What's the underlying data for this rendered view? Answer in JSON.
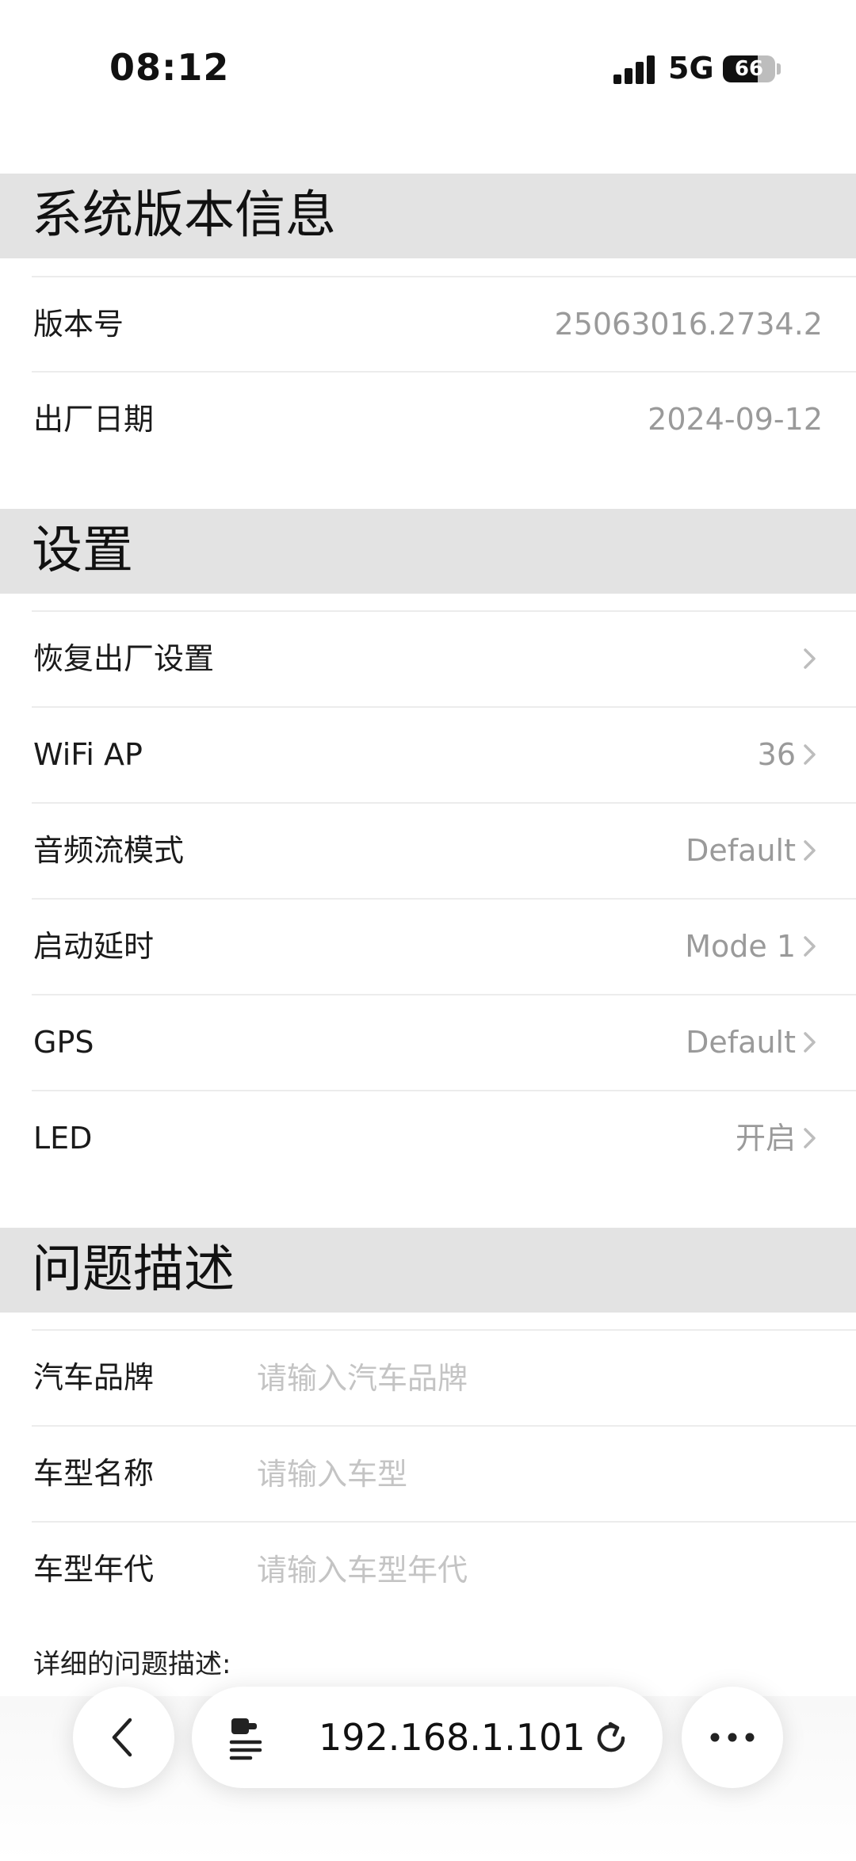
{
  "status_bar": {
    "time": "08:12",
    "network": "5G",
    "battery": "66",
    "battery_level_percent": 66,
    "icons": [
      "signal-icon",
      "battery-icon"
    ]
  },
  "sections": {
    "system": {
      "title": "系统版本信息",
      "rows": [
        {
          "label": "版本号",
          "value": "25063016.2734.2"
        },
        {
          "label": "出厂日期",
          "value": "2024-09-12"
        }
      ]
    },
    "settings": {
      "title": "设置",
      "rows": [
        {
          "label": "恢复出厂设置",
          "value": ""
        },
        {
          "label": "WiFi AP",
          "value": "36"
        },
        {
          "label": "音频流模式",
          "value": "Default"
        },
        {
          "label": "启动延时",
          "value": "Mode 1"
        },
        {
          "label": "GPS",
          "value": "Default"
        },
        {
          "label": "LED",
          "value": "开启"
        }
      ]
    },
    "problem": {
      "title": "问题描述",
      "fields": [
        {
          "label": "汽车品牌",
          "placeholder": "请输入汽车品牌",
          "value": ""
        },
        {
          "label": "车型名称",
          "placeholder": "请输入车型",
          "value": ""
        },
        {
          "label": "车型年代",
          "placeholder": "请输入车型年代",
          "value": ""
        }
      ],
      "detail_label": "详细的问题描述:"
    }
  },
  "browser_bar": {
    "url": "192.168.1.101",
    "icons": [
      "back-chevron-icon",
      "page-menu-icon",
      "reload-icon",
      "more-icon"
    ]
  },
  "colors": {
    "section_header_bg": "#e3e3e3",
    "value_text": "#9a9a9a",
    "placeholder_text": "#c4c4c4",
    "chevron": "#bdbdbd"
  }
}
